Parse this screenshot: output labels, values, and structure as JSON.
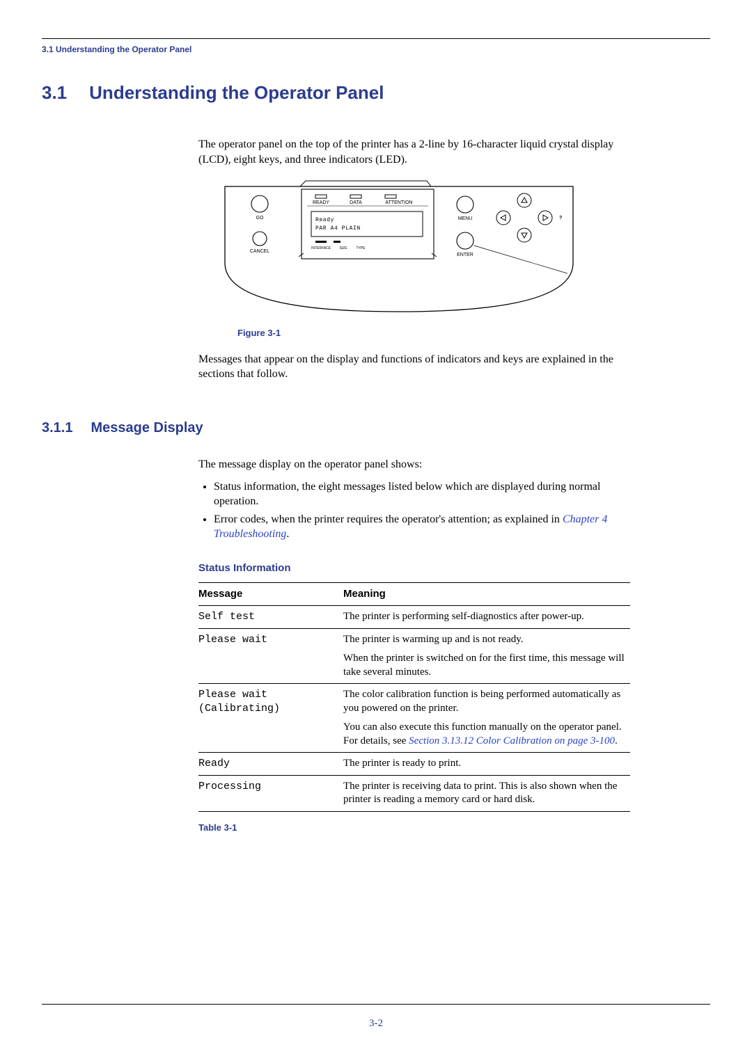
{
  "running_head": "3.1 Understanding the Operator Panel",
  "h1": {
    "num": "3.1",
    "title": "Understanding the Operator Panel"
  },
  "intro": "The operator panel on the top of the printer has a 2-line by 16-character liquid crystal display (LCD), eight keys, and three indicators (LED).",
  "figure": {
    "caption": "Figure 3-1",
    "labels": {
      "go": "GO",
      "cancel": "CANCEL",
      "ready": "READY",
      "data": "DATA",
      "attention": "ATTENTION",
      "menu": "MENU",
      "enter": "ENTER",
      "interface": "INTERFACE",
      "size": "SIZE",
      "type": "TYPE",
      "help": "?"
    },
    "lcd": {
      "line1": "Ready",
      "line2": "PAR A4 PLAIN"
    }
  },
  "after_fig": "Messages that appear on the display and functions of indicators and keys are explained in the sections that follow.",
  "h2": {
    "num": "3.1.1",
    "title": "Message Display"
  },
  "h2_intro": "The message display on the operator panel shows:",
  "bullets": {
    "b1": "Status information, the eight messages listed below which are displayed during normal operation.",
    "b2a": "Error codes, when the printer requires the operator's attention; as explained in ",
    "b2_link": "Chapter 4 Troubleshooting",
    "b2b": "."
  },
  "status_head": "Status Information",
  "table": {
    "head": {
      "message": "Message",
      "meaning": "Meaning"
    },
    "rows": [
      {
        "msg": "Self test",
        "meaning": "The printer is performing self-diagnostics after power-up."
      },
      {
        "msg": "Please wait",
        "meaning": "The printer is warming up and is not ready.",
        "extra": "When the printer is switched on for the first time, this message will take several minutes."
      },
      {
        "msg": "Please wait\n(Calibrating)",
        "meaning": "The color calibration function is being performed automatically as you powered on the printer.",
        "extra_a": "You can also execute this function manually on the operator panel. For details, see ",
        "extra_link": "Section 3.13.12 Color Calibration on page 3-100",
        "extra_b": "."
      },
      {
        "msg": "Ready",
        "meaning": "The printer is ready to print."
      },
      {
        "msg": "Processing",
        "meaning": "The printer is receiving data to print. This is also shown when the printer is reading a memory card or hard disk."
      }
    ],
    "caption": "Table 3-1"
  },
  "page_num": "3-2"
}
